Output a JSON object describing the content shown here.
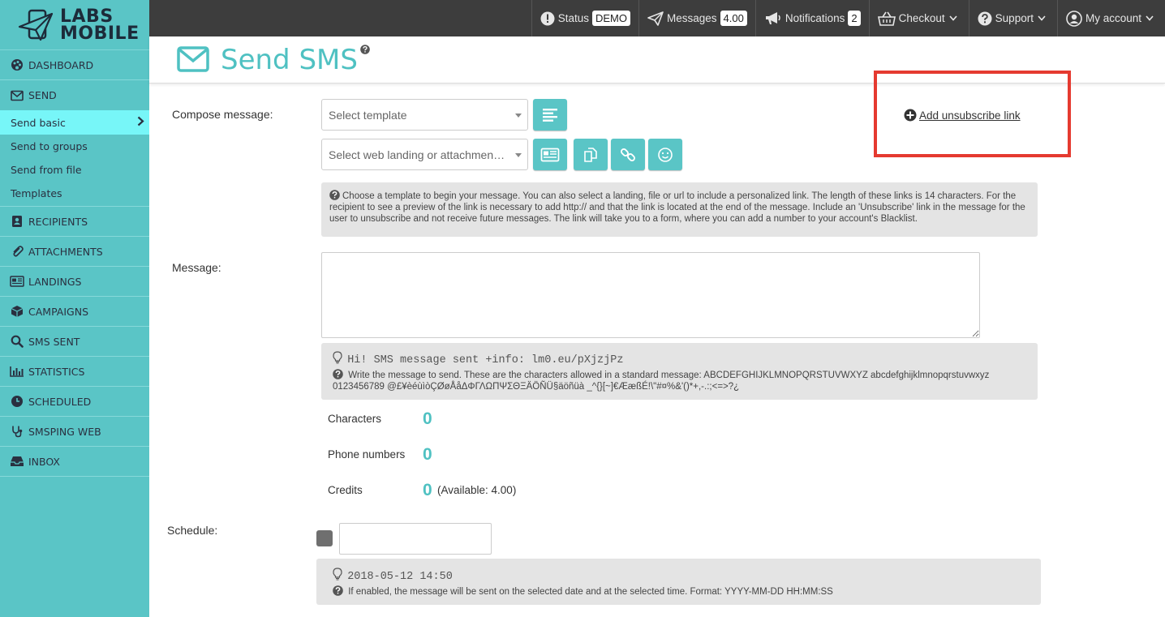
{
  "brand": {
    "line1": "LABS",
    "line2": "MOBILE"
  },
  "sidebar": {
    "items": [
      {
        "label": "DASHBOARD",
        "icon": "palette-icon"
      },
      {
        "label": "SEND",
        "icon": "envelope-icon"
      },
      {
        "label": "RECIPIENTS",
        "icon": "address-book-icon"
      },
      {
        "label": "ATTACHMENTS",
        "icon": "paperclip-icon"
      },
      {
        "label": "LANDINGS",
        "icon": "newspaper-icon"
      },
      {
        "label": "CAMPAIGNS",
        "icon": "cube-icon"
      },
      {
        "label": "SMS SENT",
        "icon": "search-icon"
      },
      {
        "label": "STATISTICS",
        "icon": "bar-chart-icon"
      },
      {
        "label": "SCHEDULED",
        "icon": "clock-icon"
      },
      {
        "label": "SMSPING WEB",
        "icon": "stethoscope-icon"
      },
      {
        "label": "INBOX",
        "icon": "inbox-icon"
      }
    ],
    "send_sub": [
      "Send basic",
      "Send to groups",
      "Send from file",
      "Templates"
    ]
  },
  "topbar": {
    "status_label": "Status",
    "status_badge": "DEMO",
    "messages_label": "Messages",
    "messages_badge": "4.00",
    "notifications_label": "Notifications",
    "notifications_badge": "2",
    "checkout_label": "Checkout",
    "support_label": "Support",
    "account_label": "My account"
  },
  "page": {
    "title": "Send SMS"
  },
  "compose": {
    "label": "Compose message:",
    "template_placeholder": "Select template",
    "landing_placeholder": "Select web landing or attachmen…",
    "unsubscribe_link": "Add unsubscribe link",
    "help": "Choose a template to begin your message. You can also select a landing, file or url to include a personalized link. The length of these links is 14 characters. For the recipient to see a preview of the link is necessary to add http:// and that the link is located at the end of the message. Include an 'Unsubscribe' link in the message for the user to unsubscribe and not receive future messages. The link will take you to a form, where you can add a number to your account's Blacklist."
  },
  "message": {
    "label": "Message:",
    "example": "Hi! SMS message sent +info: lm0.eu/pXjzjPz",
    "help": "Write the message to send. These are the characters allowed in a standard message: ABCDEFGHIJKLMNOPQRSTUVWXYZ abcdefghijklmnopqrstuvwxyz 0123456789 @£¥èéùìòÇØøÅåΔΦΓΛΩΠΨΣΘΞÄÖÑÜ§äöñüà _^{}[~]€ÆæßÉ!\\\"#¤%&'()*+,-.:;<=>?¿"
  },
  "stats": {
    "characters_label": "Characters",
    "characters_value": "0",
    "phones_label": "Phone numbers",
    "phones_value": "0",
    "credits_label": "Credits",
    "credits_value": "0",
    "credits_available": "(Available: 4.00)"
  },
  "schedule": {
    "label": "Schedule:",
    "example": "2018-05-12 14:50",
    "help": "If enabled, the message will be sent on the selected date and at the selected time. Format: YYYY-MM-DD HH:MM:SS"
  }
}
